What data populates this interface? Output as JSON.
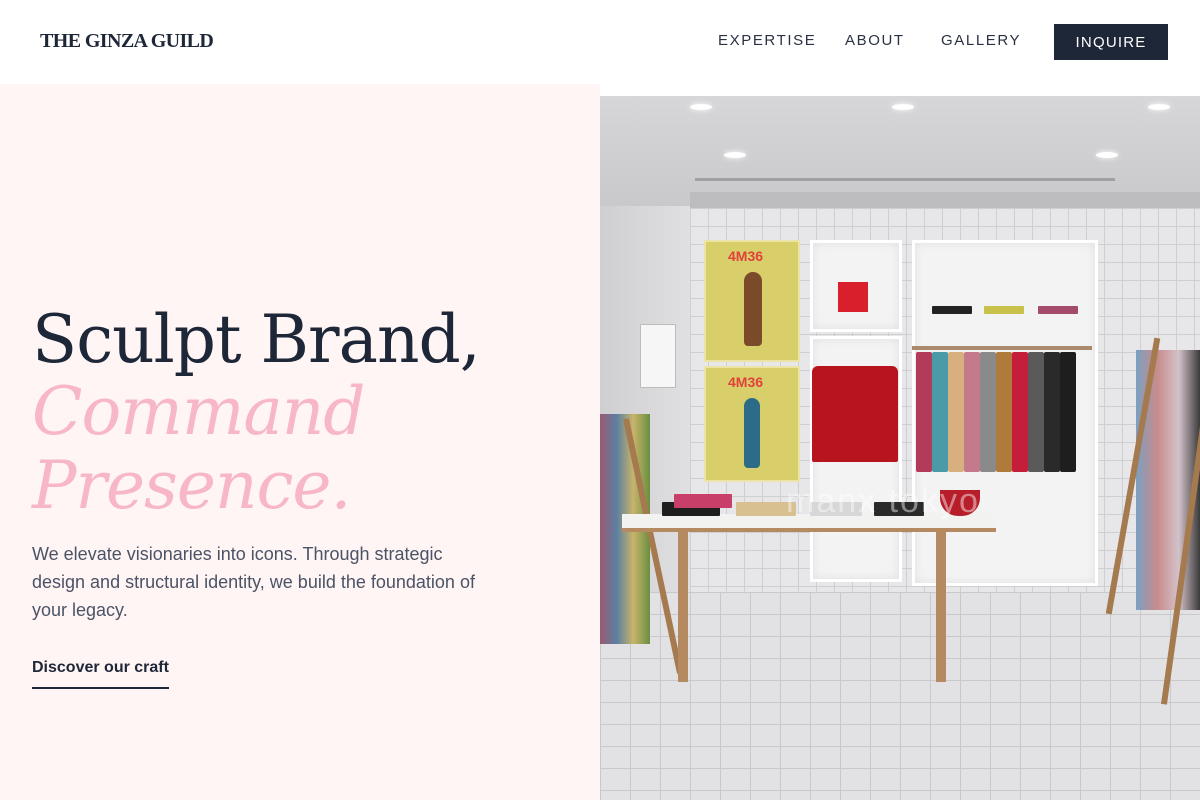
{
  "header": {
    "brand": "THE GINZA GUILD",
    "nav": [
      "EXPERTISE",
      "ABOUT",
      "GALLERY"
    ],
    "cta": "INQUIRE"
  },
  "hero": {
    "headline_line1": "Sculpt Brand,",
    "headline_line2": "Command",
    "headline_line3": "Presence.",
    "body": "We elevate visionaries into icons. Through strategic design and structural identity, we build the foundation of your legacy.",
    "link": "Discover our craft"
  },
  "photo": {
    "poster_text": "4M36",
    "watermark": "manx tokyo"
  },
  "colors": {
    "navy": "#1e2738",
    "pink": "#f7b7c6",
    "panel": "#fff5f5"
  }
}
